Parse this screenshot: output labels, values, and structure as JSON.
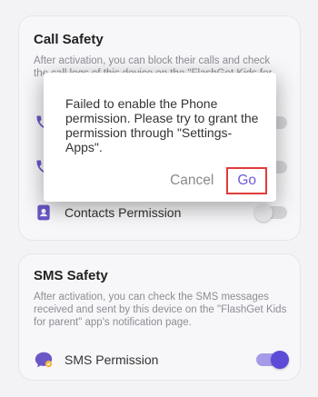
{
  "call_safety": {
    "title": "Call Safety",
    "description": "After activation, you can block their calls and check the call logs of this device on the \"FlashGet Kids for parent\" app's notification page.",
    "contacts_label": "Contacts Permission"
  },
  "sms_safety": {
    "title": "SMS Safety",
    "description": "After activation, you can check the SMS messages received and sent by this device on the \"FlashGet Kids for parent\" app's notification page.",
    "sms_label": "SMS Permission"
  },
  "dialog": {
    "message": "Failed to enable the Phone permission. Please try to grant the permission through \"Settings-Apps\".",
    "cancel_label": "Cancel",
    "go_label": "Go"
  },
  "toggles": {
    "call_perm_1": false,
    "call_perm_2": false,
    "contacts": false,
    "sms": true
  },
  "colors": {
    "accent": "#5c4bd6",
    "highlight_border": "#e23b3b",
    "icon": "#6b56c8"
  },
  "icons": {
    "call_perm_1": "phone-icon",
    "call_perm_2": "phone-icon",
    "contacts": "contacts-icon",
    "sms": "sms-icon"
  }
}
